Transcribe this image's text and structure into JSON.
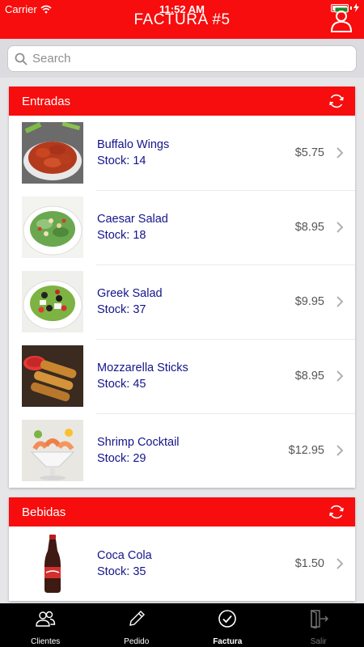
{
  "status_bar": {
    "carrier": "Carrier",
    "time": "11:52 AM"
  },
  "header": {
    "title": "FACTURA #5",
    "user_icon": "user-icon"
  },
  "search": {
    "placeholder": "Search",
    "value": ""
  },
  "colors": {
    "brand_red": "#f70d0d",
    "item_text": "#14148c",
    "tabbar_bg": "#000000"
  },
  "sections": [
    {
      "title": "Entradas",
      "items": [
        {
          "name": "Buffalo Wings",
          "stock": "Stock: 14",
          "price": "$5.75"
        },
        {
          "name": "Caesar Salad",
          "stock": "Stock: 18",
          "price": "$8.95"
        },
        {
          "name": "Greek Salad",
          "stock": "Stock: 37",
          "price": "$9.95"
        },
        {
          "name": "Mozzarella Sticks",
          "stock": "Stock: 45",
          "price": "$8.95"
        },
        {
          "name": "Shrimp Cocktail",
          "stock": "Stock: 29",
          "price": "$12.95"
        }
      ]
    },
    {
      "title": "Bebidas",
      "items": [
        {
          "name": "Coca Cola",
          "stock": "Stock: 35",
          "price": "$1.50"
        }
      ]
    }
  ],
  "tabs": [
    {
      "label": "Clientes",
      "icon": "people-icon"
    },
    {
      "label": "Pedido",
      "icon": "pencil-icon"
    },
    {
      "label": "Factura",
      "icon": "checkmark-circle-icon"
    },
    {
      "label": "Salir",
      "icon": "exit-door-icon"
    }
  ]
}
